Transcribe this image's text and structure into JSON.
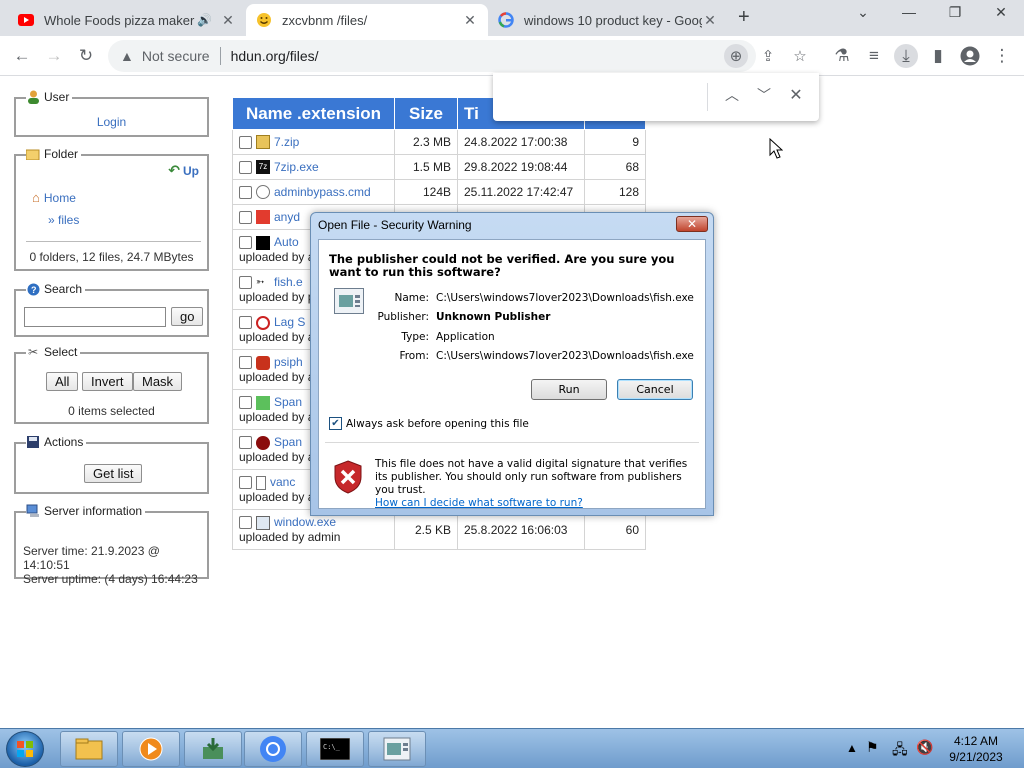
{
  "browser": {
    "tabs": [
      {
        "title": "Whole Foods pizza maker Pi",
        "icon": "youtube-icon",
        "active": false
      },
      {
        "title": "zxcvbnm /files/",
        "icon": "smiley-icon",
        "active": true
      },
      {
        "title": "windows 10 product key - Goog",
        "icon": "google-icon",
        "active": false
      }
    ],
    "security_label": "Not secure",
    "url": "hdun.org/files/"
  },
  "findbar": {
    "query": ""
  },
  "sidebar": {
    "user": {
      "legend": "User",
      "login": "Login"
    },
    "folder": {
      "legend": "Folder",
      "up": "Up",
      "home": "Home",
      "files": "» files",
      "summary": "0 folders, 12 files, 24.7 MBytes"
    },
    "search": {
      "legend": "Search",
      "button": "go",
      "value": ""
    },
    "select": {
      "legend": "Select",
      "all": "All",
      "invert": "Invert",
      "mask": "Mask",
      "status": "0 items selected"
    },
    "actions": {
      "legend": "Actions",
      "get_list": "Get list"
    },
    "server": {
      "legend": "Server information",
      "time": "Server time: 21.9.2023 @ 14:10:51",
      "uptime": "Server uptime: (4 days) 16:44:23"
    }
  },
  "files": {
    "headers": [
      "Name .extension",
      "Size",
      "Ti",
      ""
    ],
    "rows": [
      {
        "name": "7.zip",
        "size": "2.3 MB",
        "time": "24.8.2022 17:00:38",
        "hits": "9",
        "uploader": ""
      },
      {
        "name": "7zip.exe",
        "size": "1.5 MB",
        "time": "29.8.2022 19:08:44",
        "hits": "68",
        "uploader": ""
      },
      {
        "name": "adminbypass.cmd",
        "size": "124B",
        "time": "25.11.2022 17:42:47",
        "hits": "128",
        "uploader": ""
      },
      {
        "name": "anyd",
        "size": "",
        "time": "",
        "hits": "",
        "uploader": ""
      },
      {
        "name": "Auto",
        "size": "",
        "time": "",
        "hits": "",
        "uploader": "uploaded by a"
      },
      {
        "name": "fish.e",
        "size": "",
        "time": "",
        "hits": "",
        "uploader": "uploaded by p"
      },
      {
        "name": "Lag S",
        "size": "",
        "time": "",
        "hits": "",
        "uploader": "uploaded by a"
      },
      {
        "name": "psiph",
        "size": "",
        "time": "",
        "hits": "",
        "uploader": "uploaded by a"
      },
      {
        "name": "Span",
        "size": "",
        "time": "",
        "hits": "",
        "uploader": "uploaded by a"
      },
      {
        "name": "Span",
        "size": "",
        "time": "",
        "hits": "",
        "uploader": "uploaded by a"
      },
      {
        "name": "vanc",
        "size": "",
        "time": "",
        "hits": "",
        "uploader": "uploaded by a"
      },
      {
        "name": "window.exe",
        "size": "2.5 KB",
        "time": "25.8.2022 16:06:03",
        "hits": "60",
        "uploader": "uploaded by admin"
      }
    ]
  },
  "dialog": {
    "title": "Open File - Security Warning",
    "question": "The publisher could not be verified.  Are you sure you want to run this software?",
    "fields": [
      {
        "label": "Name:",
        "value": "C:\\Users\\windows7lover2023\\Downloads\\fish.exe"
      },
      {
        "label": "Publisher:",
        "value": "Unknown Publisher"
      },
      {
        "label": "Type:",
        "value": "Application"
      },
      {
        "label": "From:",
        "value": "C:\\Users\\windows7lover2023\\Downloads\\fish.exe"
      }
    ],
    "run": "Run",
    "cancel": "Cancel",
    "checkbox_label": "Always ask before opening this file",
    "footer": "This file does not have a valid digital signature that verifies its publisher.  You should only run software from publishers you trust.",
    "footer_link": "How can I decide what software to run?"
  },
  "taskbar": {
    "time": "4:12 AM",
    "date": "9/21/2023"
  }
}
